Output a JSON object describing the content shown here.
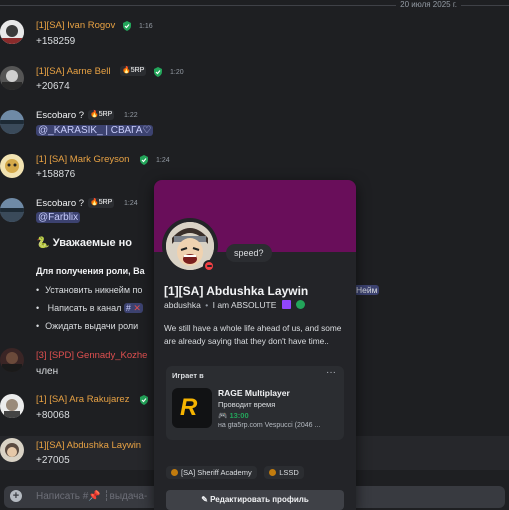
{
  "date_divider": "20 июля 2025 г.",
  "messages": [
    {
      "author": "[1][SA] Ivan Rogov",
      "time": "1:16",
      "text": "+158259"
    },
    {
      "author": "[1][SA] Aarne Bell",
      "badge": "5RP",
      "time": "1:20",
      "text": "+20674"
    },
    {
      "author": "Escobaro ?",
      "badge": "5RP",
      "time": "1:22",
      "mention": "@_KARASIK_ | СВАГА♡"
    },
    {
      "author": "[1] [SA] Mark Greyson",
      "time": "1:24",
      "text": "+158876"
    },
    {
      "author": "Escobaro ?",
      "badge": "5RP",
      "time": "1:24",
      "mention": "@Farblix"
    },
    {
      "author": "[3] [SPD] Gennady_Kozhe",
      "text": "член"
    },
    {
      "author": "[1] [SA] Ara Rakujarez",
      "text": "+80068"
    },
    {
      "author": "[1][SA] Abdushka Laywin",
      "text": "+27005"
    }
  ],
  "announcement": {
    "heading": "Уважаемые но",
    "subheading": "Для получения роли, Ва",
    "bullets": [
      "Установить никнейм по",
      "Написать в канал",
      "Ожидать выдачи роли"
    ],
    "channel_tag": "#",
    "role_mention": "Нейм"
  },
  "input": {
    "placeholder": "Написать #📌 ┆выдача-"
  },
  "profile": {
    "display_name": "[1][SA] Abdushka Laywin",
    "username": "abdushka",
    "tagline": "I am ABSOLUTE",
    "status_bubble": "speed?",
    "bio": "We still have a whole life ahead of us, and some are already saying that they don't have time..",
    "activity": {
      "header": "Играет в",
      "more": "···",
      "title": "RAGE Multiplayer",
      "subtitle": "Проводит время",
      "elapsed": "13:00",
      "location": "на gta5rp.com Vespucci (2046 ..."
    },
    "roles": [
      "[SA] Sheriff Academy",
      "LSSD"
    ],
    "edit_button": "Редактировать профиль"
  },
  "colors": {
    "popout_banner": "#690e5a",
    "orange_name": "#e8a244",
    "red_name": "#e05050",
    "dnd": "#f23f43"
  },
  "icons": [
    "shield-check-icon",
    "flame-icon",
    "snake-emoji-icon",
    "pin-icon",
    "plus-circle-icon",
    "gamepad-icon",
    "pencil-icon",
    "twitch-icon"
  ]
}
